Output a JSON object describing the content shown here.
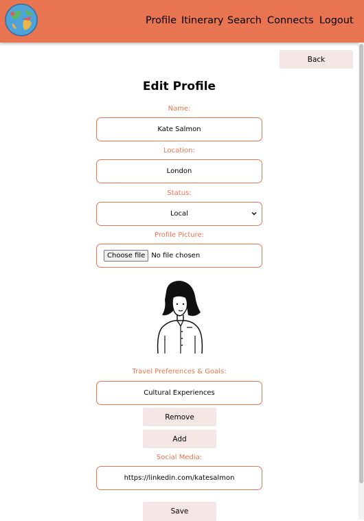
{
  "nav": {
    "links": [
      "Profile",
      "Itinerary",
      "Search",
      "Connects",
      "Logout"
    ]
  },
  "back_label": "Back",
  "page_title": "Edit Profile",
  "form": {
    "name_label": "Name:",
    "name_value": "Kate Salmon",
    "location_label": "Location:",
    "location_value": "London",
    "status_label": "Status:",
    "status_value": "Local",
    "picture_label": "Profile Picture:",
    "file_button": "Choose file",
    "file_status": "No file chosen",
    "travel_label": "Travel Preferences & Goals:",
    "travel_value": "Cultural Experiences",
    "remove_label": "Remove",
    "add_label": "Add",
    "social_label": "Social Media:",
    "social_value": "https://linkedin.com/katesalmon",
    "save_label": "Save"
  },
  "colors": {
    "accent": "#E97451",
    "button_bg": "#F4E6E4"
  },
  "icons": {
    "logo": "globe-logo-icon",
    "select": "chevron-down-icon",
    "avatar": "profile-avatar-illustration"
  }
}
